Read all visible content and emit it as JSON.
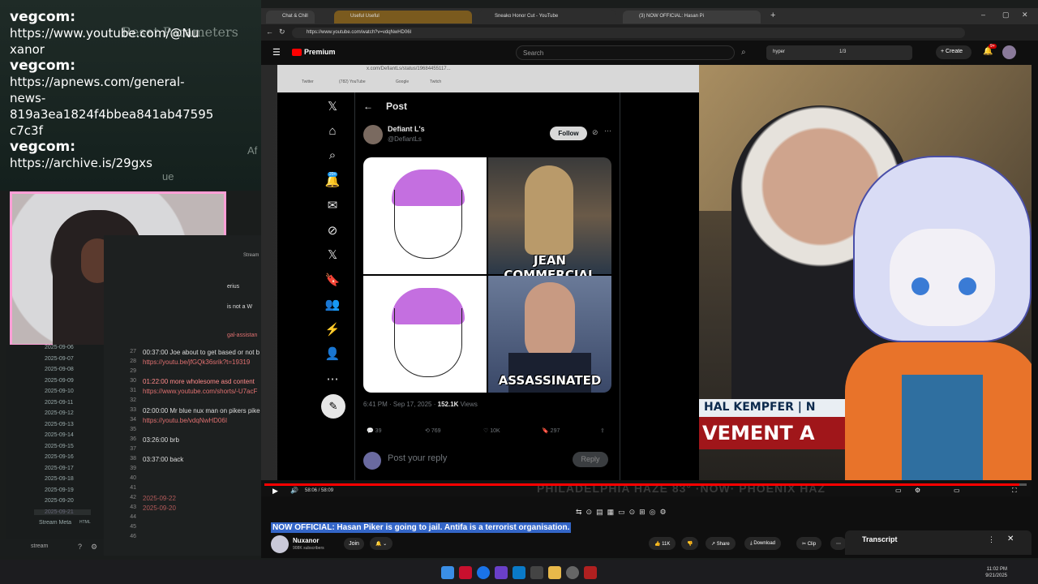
{
  "chat": {
    "bg_title": "Reset Parameters",
    "bg_side_text": "Af",
    "lines": [
      {
        "text": "vegcom:",
        "user": true
      },
      {
        "text": "https://www.youtube.com/@Nu",
        "user": false
      },
      {
        "text": "xanor",
        "user": false
      },
      {
        "text": "vegcom:",
        "user": true
      },
      {
        "text": "https://apnews.com/general-",
        "user": false
      },
      {
        "text": "news-",
        "user": false
      },
      {
        "text": "819a3ea1824f4bbea841ab47595",
        "user": false
      },
      {
        "text": "c7c3f",
        "user": false
      },
      {
        "text": "vegcom:",
        "user": true
      },
      {
        "text": "https://archive.is/29gxs",
        "user": false
      }
    ]
  },
  "notes_panel": {
    "header_label": "Stream",
    "side_snippets": [
      "erius",
      "is not a W",
      "gal-assistan"
    ],
    "lines": [
      {
        "n": "27",
        "text": "00:37:00 Joe about to get based or not b",
        "kind": "normal"
      },
      {
        "n": "28",
        "text": "https://youtu.be/jfGQk36srik?t=19319",
        "kind": "link"
      },
      {
        "n": "29",
        "text": "",
        "kind": "normal"
      },
      {
        "n": "30",
        "text": "01:22:00 more wholesome asd content",
        "kind": "red"
      },
      {
        "n": "31",
        "text": "https://www.youtube.com/shorts/-U7acF",
        "kind": "link"
      },
      {
        "n": "32",
        "text": "",
        "kind": "normal"
      },
      {
        "n": "33",
        "text": "02:00:00 Mr blue nux man on pikers pike",
        "kind": "normal"
      },
      {
        "n": "34",
        "text": "https://youtu.be/vdqNwHD06I",
        "kind": "link"
      },
      {
        "n": "35",
        "text": "",
        "kind": "normal"
      },
      {
        "n": "36",
        "text": "03:26:00 brb",
        "kind": "normal"
      },
      {
        "n": "37",
        "text": "",
        "kind": "normal"
      },
      {
        "n": "38",
        "text": "03:37:00 back",
        "kind": "normal"
      },
      {
        "n": "39",
        "text": "",
        "kind": "normal"
      },
      {
        "n": "40",
        "text": "",
        "kind": "normal"
      },
      {
        "n": "41",
        "text": "",
        "kind": "normal"
      },
      {
        "n": "42",
        "text": "2025-09-22",
        "kind": "dim"
      },
      {
        "n": "43",
        "text": "2025-09-20",
        "kind": "dim"
      },
      {
        "n": "44",
        "text": "",
        "kind": "normal"
      },
      {
        "n": "45",
        "text": "",
        "kind": "normal"
      },
      {
        "n": "46",
        "text": "",
        "kind": "normal"
      }
    ],
    "dates": [
      "2025-09-06",
      "2025-09-07",
      "2025-09-08",
      "2025-09-09",
      "2025-09-10",
      "2025-09-11",
      "2025-09-12",
      "2025-09-13",
      "2025-09-14",
      "2025-09-15",
      "2025-09-16",
      "2025-09-17",
      "2025-09-18",
      "2025-09-19",
      "2025-09-20",
      "2025-09-21"
    ],
    "stream_meta": "Stream Meta",
    "stream_meta_badge": "HTML",
    "stream_tab": "stream"
  },
  "browser": {
    "tabs": [
      {
        "label": "Chat & Chill",
        "color": "#3a3a3a"
      },
      {
        "label": "Useful Useful",
        "color": "#7a5a1e"
      },
      {
        "label": "Sneako Honor Cut - YouTube",
        "color": "#2d2d2d"
      },
      {
        "label": "(3) NOW OFFICIAL: Hasan Pi",
        "color": "#3c3c3c"
      }
    ],
    "url": "https://www.youtube.com/watch?v=vdqNwHD06I",
    "yt_brand": "Premium",
    "search_placeholder": "Search",
    "find_query": "hyper",
    "find_count": "1/3",
    "create_label": "Create",
    "notif_count": "9+"
  },
  "x_post": {
    "chrome_url": "x.com/DefiantLs/status/19684455117...",
    "bookmarks": [
      "Twitter",
      "(782) YouTube",
      "Google",
      "Twitch"
    ],
    "header": "Post",
    "name": "Defiant L's",
    "handle": "@DefiantLs",
    "follow_label": "Follow",
    "caption_top": "JEAN COMMERCIAL",
    "caption_bottom": "ASSASSINATED",
    "time": "6:41 PM · Sep 17, 2025 ·",
    "views_count": "152.1K",
    "views_label": "Views",
    "stats": {
      "replies": "39",
      "reposts": "769",
      "likes": "10K",
      "bookmarks": "297"
    },
    "reply_placeholder": "Post your reply",
    "reply_button": "Reply",
    "nav_badge": "20+"
  },
  "news": {
    "lower_third_name": "HAL KEMPFER | N",
    "lower_third_banner": "VEMENT A",
    "ticker": "PHILADELPHIA  HAZE 83°  ·NOW·  PHOENIX  HAZ"
  },
  "player": {
    "time": "58:06 / 58:09",
    "progress": 0.99
  },
  "video_info": {
    "title": "NOW OFFICIAL: Hasan Piker is going to jail. Antifa is a terrorist organisation.",
    "channel": "Nuxanor",
    "subscribers": "908K subscribers",
    "join_label": "Join",
    "likes": "11K",
    "share_label": "Share",
    "download_label": "Download",
    "clip_label": "Clip",
    "transcript_label": "Transcript"
  },
  "taskbar": {
    "time": "11:02 PM",
    "date": "9/21/2025"
  }
}
